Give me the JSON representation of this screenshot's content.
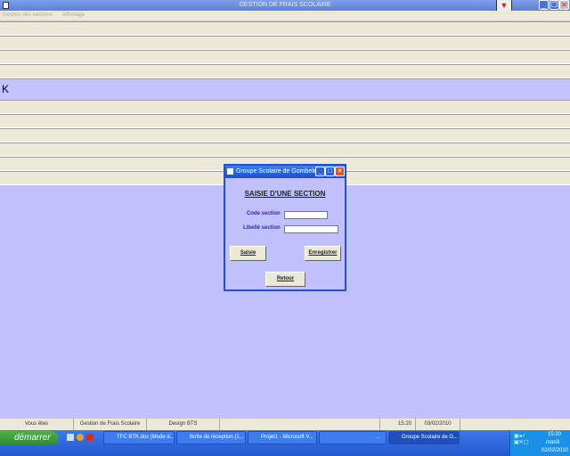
{
  "window": {
    "title": "GESTION DE FRAIS SCOLAIRE"
  },
  "menu": [
    "Gestion des sections",
    "Affichage"
  ],
  "grid_cell_text": "K",
  "dialog": {
    "title": "Groupe Scolaire de Gombele",
    "heading": "SAISIE D'UNE SECTION",
    "code_label": "Code section",
    "code_value": "",
    "libelle_label": "Libellé section",
    "libelle_value": "",
    "saisie": "Saisie",
    "enregistrer": "Enregistrer",
    "retour": "Retour"
  },
  "statusbar": [
    "Vous êtes",
    "Gestion de Frais Scolaire",
    "Design BTS",
    "",
    "15:20",
    "03/02/2010"
  ],
  "taskbar": {
    "start": "démarrer",
    "tasks": [
      "TFC BTK.doc [Mode d...",
      "Boîte de réception (1...",
      "Projet1 - Microsoft V...",
      "...",
      "Groupe Scolaire de G..."
    ],
    "clock": "15:20",
    "day": "mardi",
    "date": "02/02/2010"
  }
}
